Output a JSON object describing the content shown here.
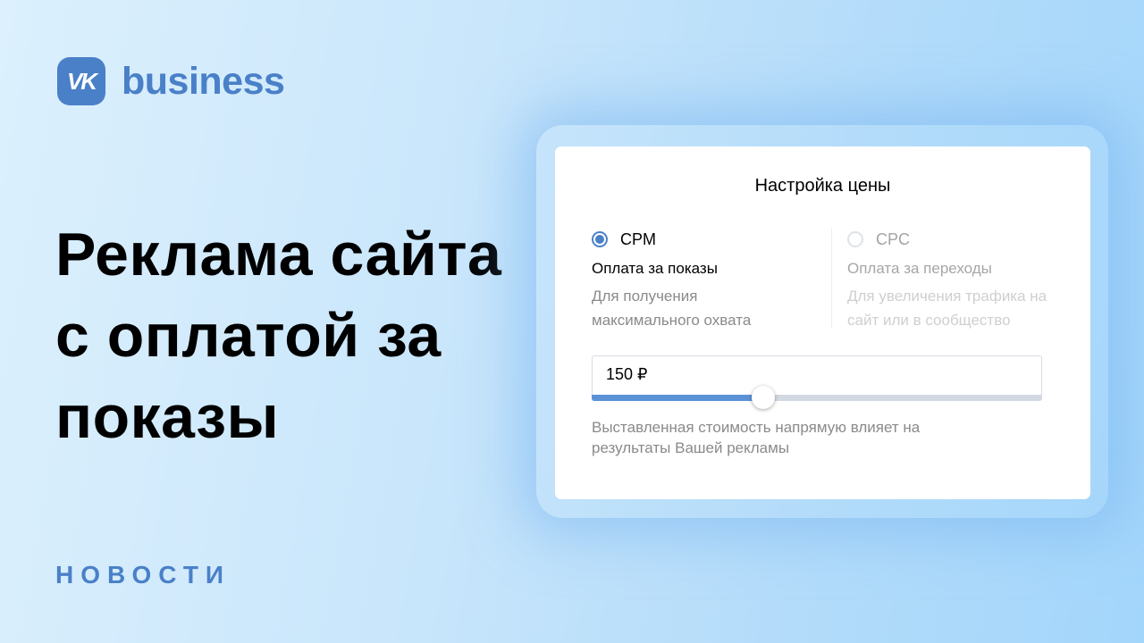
{
  "brand": {
    "badge": "VK",
    "name": "business",
    "color": "#4a80c8"
  },
  "headline": "Реклама сайта с оплатой за показы",
  "section_label": "НОВОСТИ",
  "card": {
    "title": "Настройка цены",
    "options": [
      {
        "name": "CPM",
        "selected": true,
        "subtitle": "Оплата за показы",
        "description": "Для получения максимального охвата"
      },
      {
        "name": "CPC",
        "selected": false,
        "subtitle": "Оплата за переходы",
        "description": "Для увеличения трафика на сайт или в сообщество"
      }
    ],
    "price_value": "150 ₽",
    "slider_fraction": 0.38,
    "hint": "Выставленная стоимость напрямую влияет на результаты Вашей рекламы"
  }
}
